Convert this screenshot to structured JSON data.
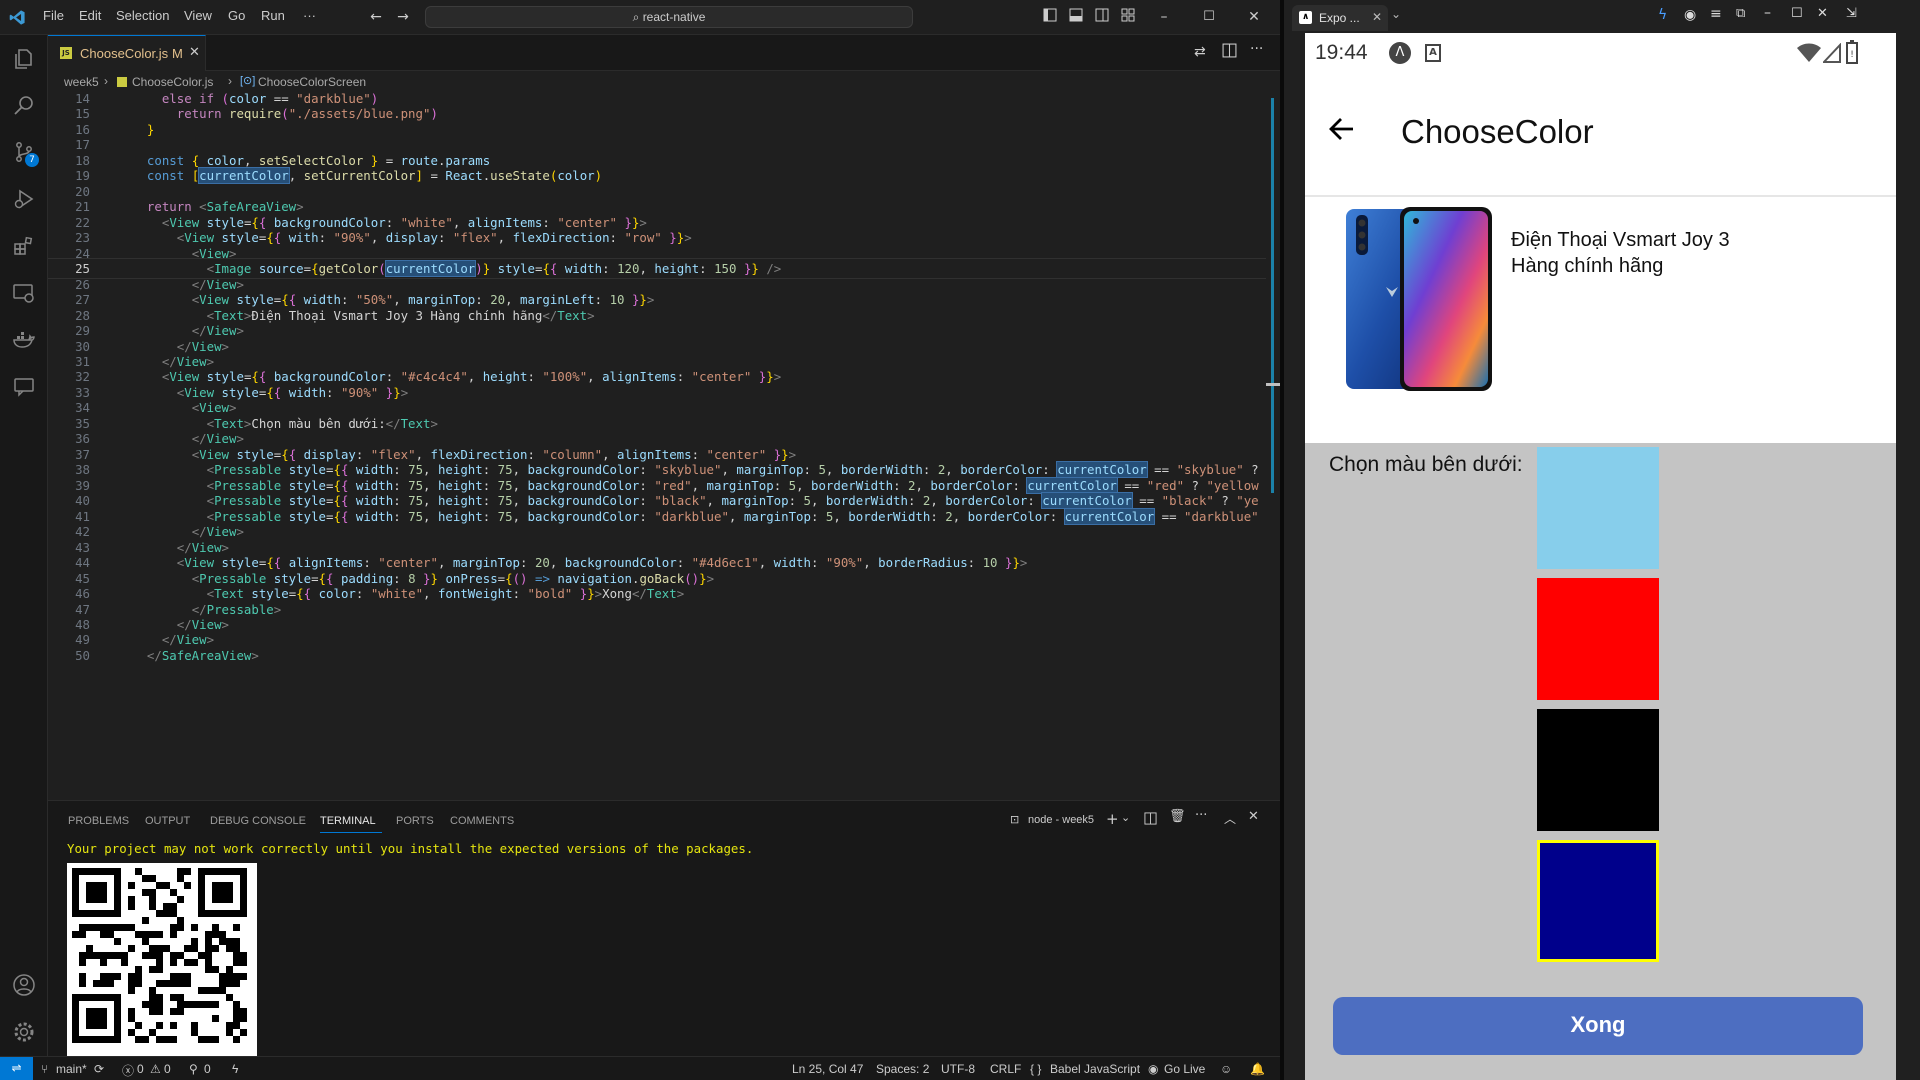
{
  "vscode": {
    "menu": [
      "File",
      "Edit",
      "Selection",
      "View",
      "Go",
      "Run",
      "···"
    ],
    "command_center": "react-native",
    "tab": {
      "filename": "ChooseColor.js",
      "status": "M"
    },
    "breadcrumb": {
      "folder": "week5",
      "file": "ChooseColor.js",
      "symbol": "ChooseColorScreen"
    },
    "source_control_badge": "7",
    "code_lines": [
      {
        "n": "14",
        "html": "    <span class='kc'>else</span> <span class='kc'>if</span> <span class='b2'>(</span><span class='v'>color</span> == <span class='s'>\"darkblue\"</span><span class='b2'>)</span>"
      },
      {
        "n": "15",
        "html": "      <span class='kc'>return</span> <span class='f'>require</span><span class='b2'>(</span><span class='s'>\"./assets/blue.png\"</span><span class='b2'>)</span>"
      },
      {
        "n": "16",
        "html": "  <span class='b1'>}</span>"
      },
      {
        "n": "17",
        "html": ""
      },
      {
        "n": "18",
        "html": "  <span class='k'>const</span> <span class='b1'>{</span> <span class='v'>color</span>, <span class='f'>setSelectColor</span> <span class='b1'>}</span> = <span class='v'>route</span>.<span class='v'>params</span>"
      },
      {
        "n": "19",
        "html": "  <span class='k'>const</span> <span class='b1'>[</span><span class='v hl'>currentColor</span>, <span class='f'>setCurrentColor</span><span class='b1'>]</span> = <span class='v'>React</span>.<span class='f'>useState</span><span class='b1'>(</span><span class='v'>color</span><span class='b1'>)</span>"
      },
      {
        "n": "20",
        "html": ""
      },
      {
        "n": "21",
        "html": "  <span class='kc'>return</span> <span class='t'>&lt;</span><span class='c'>SafeAreaView</span><span class='t'>&gt;</span>"
      },
      {
        "n": "22",
        "html": "    <span class='t'>&lt;</span><span class='c'>View</span> <span class='v'>style</span>=<span class='b1'>{</span><span class='b2'>{</span> <span class='v'>backgroundColor</span>: <span class='s'>\"white\"</span>, <span class='v'>alignItems</span>: <span class='s'>\"center\"</span> <span class='b2'>}</span><span class='b1'>}</span><span class='t'>&gt;</span>"
      },
      {
        "n": "23",
        "html": "      <span class='t'>&lt;</span><span class='c'>View</span> <span class='v'>style</span>=<span class='b1'>{</span><span class='b2'>{</span> <span class='v'>with</span>: <span class='s'>\"90%\"</span>, <span class='v'>display</span>: <span class='s'>\"flex\"</span>, <span class='v'>flexDirection</span>: <span class='s'>\"row\"</span> <span class='b2'>}</span><span class='b1'>}</span><span class='t'>&gt;</span>"
      },
      {
        "n": "24",
        "html": "        <span class='t'>&lt;</span><span class='c'>View</span><span class='t'>&gt;</span>"
      },
      {
        "n": "25",
        "html": "          <span class='t'>&lt;</span><span class='c'>Image</span> <span class='v'>source</span>=<span class='b1'>{</span><span class='f'>getColor</span><span class='b2'>(</span><span class='v hl'>currentColor</span><span class='b2'>)</span><span class='b1'>}</span> <span class='v'>style</span>=<span class='b1'>{</span><span class='b2'>{</span> <span class='v'>width</span>: <span class='n'>120</span>, <span class='v'>height</span>: <span class='n'>150</span> <span class='b2'>}</span><span class='b1'>}</span> <span class='t'>/&gt;</span>"
      },
      {
        "n": "26",
        "html": "        <span class='t'>&lt;/</span><span class='c'>View</span><span class='t'>&gt;</span>"
      },
      {
        "n": "27",
        "html": "        <span class='t'>&lt;</span><span class='c'>View</span> <span class='v'>style</span>=<span class='b1'>{</span><span class='b2'>{</span> <span class='v'>width</span>: <span class='s'>\"50%\"</span>, <span class='v'>marginTop</span>: <span class='n'>20</span>, <span class='v'>marginLeft</span>: <span class='n'>10</span> <span class='b2'>}</span><span class='b1'>}</span><span class='t'>&gt;</span>"
      },
      {
        "n": "28",
        "html": "          <span class='t'>&lt;</span><span class='c'>Text</span><span class='t'>&gt;</span>Điện Thoại Vsmart Joy 3 Hàng chính hãng<span class='t'>&lt;/</span><span class='c'>Text</span><span class='t'>&gt;</span>"
      },
      {
        "n": "29",
        "html": "        <span class='t'>&lt;/</span><span class='c'>View</span><span class='t'>&gt;</span>"
      },
      {
        "n": "30",
        "html": "      <span class='t'>&lt;/</span><span class='c'>View</span><span class='t'>&gt;</span>"
      },
      {
        "n": "31",
        "html": "    <span class='t'>&lt;/</span><span class='c'>View</span><span class='t'>&gt;</span>"
      },
      {
        "n": "32",
        "html": "    <span class='t'>&lt;</span><span class='c'>View</span> <span class='v'>style</span>=<span class='b1'>{</span><span class='b2'>{</span> <span class='v'>backgroundColor</span>: <span class='s'>\"#c4c4c4\"</span>, <span class='v'>height</span>: <span class='s'>\"100%\"</span>, <span class='v'>alignItems</span>: <span class='s'>\"center\"</span> <span class='b2'>}</span><span class='b1'>}</span><span class='t'>&gt;</span>"
      },
      {
        "n": "33",
        "html": "      <span class='t'>&lt;</span><span class='c'>View</span> <span class='v'>style</span>=<span class='b1'>{</span><span class='b2'>{</span> <span class='v'>width</span>: <span class='s'>\"90%\"</span> <span class='b2'>}</span><span class='b1'>}</span><span class='t'>&gt;</span>"
      },
      {
        "n": "34",
        "html": "        <span class='t'>&lt;</span><span class='c'>View</span><span class='t'>&gt;</span>"
      },
      {
        "n": "35",
        "html": "          <span class='t'>&lt;</span><span class='c'>Text</span><span class='t'>&gt;</span>Chọn màu bên dưới:<span class='t'>&lt;/</span><span class='c'>Text</span><span class='t'>&gt;</span>"
      },
      {
        "n": "36",
        "html": "        <span class='t'>&lt;/</span><span class='c'>View</span><span class='t'>&gt;</span>"
      },
      {
        "n": "37",
        "html": "        <span class='t'>&lt;</span><span class='c'>View</span> <span class='v'>style</span>=<span class='b1'>{</span><span class='b2'>{</span> <span class='v'>display</span>: <span class='s'>\"flex\"</span>, <span class='v'>flexDirection</span>: <span class='s'>\"column\"</span>, <span class='v'>alignItems</span>: <span class='s'>\"center\"</span> <span class='b2'>}</span><span class='b1'>}</span><span class='t'>&gt;</span>"
      },
      {
        "n": "38",
        "html": "          <span class='t'>&lt;</span><span class='c'>Pressable</span> <span class='v'>style</span>=<span class='b1'>{</span><span class='b2'>{</span> <span class='v'>width</span>: <span class='n'>75</span>, <span class='v'>height</span>: <span class='n'>75</span>, <span class='v'>backgroundColor</span>: <span class='s'>\"skyblue\"</span>, <span class='v'>marginTop</span>: <span class='n'>5</span>, <span class='v'>borderWidth</span>: <span class='n'>2</span>, <span class='v'>borderColor</span>: <span class='v hl'>currentColor</span> == <span class='s'>\"skyblue\"</span> ?"
      },
      {
        "n": "39",
        "html": "          <span class='t'>&lt;</span><span class='c'>Pressable</span> <span class='v'>style</span>=<span class='b1'>{</span><span class='b2'>{</span> <span class='v'>width</span>: <span class='n'>75</span>, <span class='v'>height</span>: <span class='n'>75</span>, <span class='v'>backgroundColor</span>: <span class='s'>\"red\"</span>, <span class='v'>marginTop</span>: <span class='n'>5</span>, <span class='v'>borderWidth</span>: <span class='n'>2</span>, <span class='v'>borderColor</span>: <span class='v hl'>currentColor</span> == <span class='s'>\"red\"</span> ? <span class='s'>\"yellow</span>"
      },
      {
        "n": "40",
        "html": "          <span class='t'>&lt;</span><span class='c'>Pressable</span> <span class='v'>style</span>=<span class='b1'>{</span><span class='b2'>{</span> <span class='v'>width</span>: <span class='n'>75</span>, <span class='v'>height</span>: <span class='n'>75</span>, <span class='v'>backgroundColor</span>: <span class='s'>\"black\"</span>, <span class='v'>marginTop</span>: <span class='n'>5</span>, <span class='v'>borderWidth</span>: <span class='n'>2</span>, <span class='v'>borderColor</span>: <span class='v hl'>currentColor</span> == <span class='s'>\"black\"</span> ? <span class='s'>\"ye</span>"
      },
      {
        "n": "41",
        "html": "          <span class='t'>&lt;</span><span class='c'>Pressable</span> <span class='v'>style</span>=<span class='b1'>{</span><span class='b2'>{</span> <span class='v'>width</span>: <span class='n'>75</span>, <span class='v'>height</span>: <span class='n'>75</span>, <span class='v'>backgroundColor</span>: <span class='s'>\"darkblue\"</span>, <span class='v'>marginTop</span>: <span class='n'>5</span>, <span class='v'>borderWidth</span>: <span class='n'>2</span>, <span class='v'>borderColor</span>: <span class='v hl'>currentColor</span> == <span class='s'>\"darkblue\"</span>"
      },
      {
        "n": "42",
        "html": "        <span class='t'>&lt;/</span><span class='c'>View</span><span class='t'>&gt;</span>"
      },
      {
        "n": "43",
        "html": "      <span class='t'>&lt;/</span><span class='c'>View</span><span class='t'>&gt;</span>"
      },
      {
        "n": "44",
        "html": "      <span class='t'>&lt;</span><span class='c'>View</span> <span class='v'>style</span>=<span class='b1'>{</span><span class='b2'>{</span> <span class='v'>alignItems</span>: <span class='s'>\"center\"</span>, <span class='v'>marginTop</span>: <span class='n'>20</span>, <span class='v'>backgroundColor</span>: <span class='s'>\"#4d6ec1\"</span>, <span class='v'>width</span>: <span class='s'>\"90%\"</span>, <span class='v'>borderRadius</span>: <span class='n'>10</span> <span class='b2'>}</span><span class='b1'>}</span><span class='t'>&gt;</span>"
      },
      {
        "n": "45",
        "html": "        <span class='t'>&lt;</span><span class='c'>Pressable</span> <span class='v'>style</span>=<span class='b1'>{</span><span class='b2'>{</span> <span class='v'>padding</span>: <span class='n'>8</span> <span class='b2'>}</span><span class='b1'>}</span> <span class='v'>onPress</span>=<span class='b1'>{</span><span class='b2'>()</span> <span class='k'>=&gt;</span> <span class='v'>navigation</span>.<span class='f'>goBack</span><span class='b2'>()</span><span class='b1'>}</span><span class='t'>&gt;</span>"
      },
      {
        "n": "46",
        "html": "          <span class='t'>&lt;</span><span class='c'>Text</span> <span class='v'>style</span>=<span class='b1'>{</span><span class='b2'>{</span> <span class='v'>color</span>: <span class='s'>\"white\"</span>, <span class='v'>fontWeight</span>: <span class='s'>\"bold\"</span> <span class='b2'>}</span><span class='b1'>}</span><span class='t'>&gt;</span>Xong<span class='t'>&lt;/</span><span class='c'>Text</span><span class='t'>&gt;</span>"
      },
      {
        "n": "47",
        "html": "        <span class='t'>&lt;/</span><span class='c'>Pressable</span><span class='t'>&gt;</span>"
      },
      {
        "n": "48",
        "html": "      <span class='t'>&lt;/</span><span class='c'>View</span><span class='t'>&gt;</span>"
      },
      {
        "n": "49",
        "html": "    <span class='t'>&lt;/</span><span class='c'>View</span><span class='t'>&gt;</span>"
      },
      {
        "n": "50",
        "html": "  <span class='t'>&lt;/</span><span class='c'>SafeAreaView</span><span class='t'>&gt;</span>"
      }
    ],
    "panel_tabs": [
      "PROBLEMS",
      "OUTPUT",
      "DEBUG CONSOLE",
      "TERMINAL",
      "PORTS",
      "COMMENTS"
    ],
    "active_panel_tab": "TERMINAL",
    "terminal_name": "node - week5",
    "terminal_warning": "Your project may not work correctly until you install the expected versions of the packages.",
    "status": {
      "branch": "main*",
      "errors": "0",
      "warnings": "0",
      "ports": "0",
      "cursor": "Ln 25, Col 47",
      "spaces": "Spaces: 2",
      "encoding": "UTF-8",
      "eol": "CRLF",
      "language": "Babel JavaScript",
      "golive": "Go Live"
    }
  },
  "emulator": {
    "tab_title": "Expo ...",
    "time": "19:44",
    "screen_title": "ChooseColor",
    "product_name": "Điện Thoại Vsmart Joy 3 Hàng chính hãng",
    "choose_label": "Chọn màu bên dưới:",
    "swatches": [
      {
        "name": "skyblue",
        "color": "#87ceeb",
        "selected": false
      },
      {
        "name": "red",
        "color": "#ff0000",
        "selected": false
      },
      {
        "name": "black",
        "color": "#000000",
        "selected": false
      },
      {
        "name": "darkblue",
        "color": "#00008b",
        "selected": true
      }
    ],
    "selected_border_color": "#ffff00",
    "done_button": "Xong",
    "accent": "#4d6ec1"
  }
}
